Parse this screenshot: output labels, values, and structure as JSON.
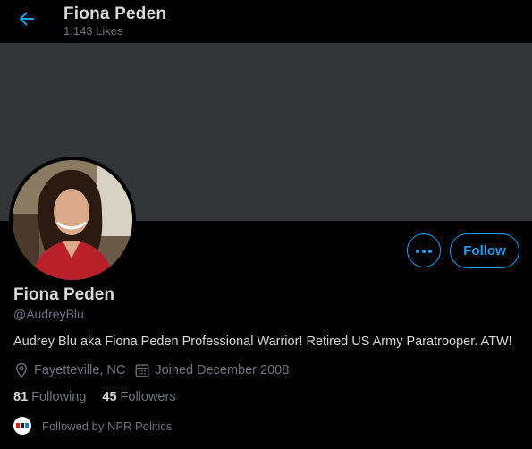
{
  "header": {
    "title": "Fiona Peden",
    "likes": "1,143 Likes"
  },
  "profile": {
    "name": "Fiona Peden",
    "handle": "@AudreyBlu",
    "bio": "Audrey Blu aka Fiona Peden Professional Warrior! Retired US Army Paratrooper. ATW!",
    "location": "Fayetteville, NC",
    "joined": "Joined December 2008",
    "following_count": "81",
    "following_label": "Following",
    "followers_count": "45",
    "followers_label": "Followers",
    "followed_by": "Followed by NPR Politics"
  },
  "actions": {
    "follow_label": "Follow",
    "more_icon": "more-icon"
  },
  "colors": {
    "accent": "#1da1f2",
    "banner": "#333639",
    "background": "#000000"
  }
}
